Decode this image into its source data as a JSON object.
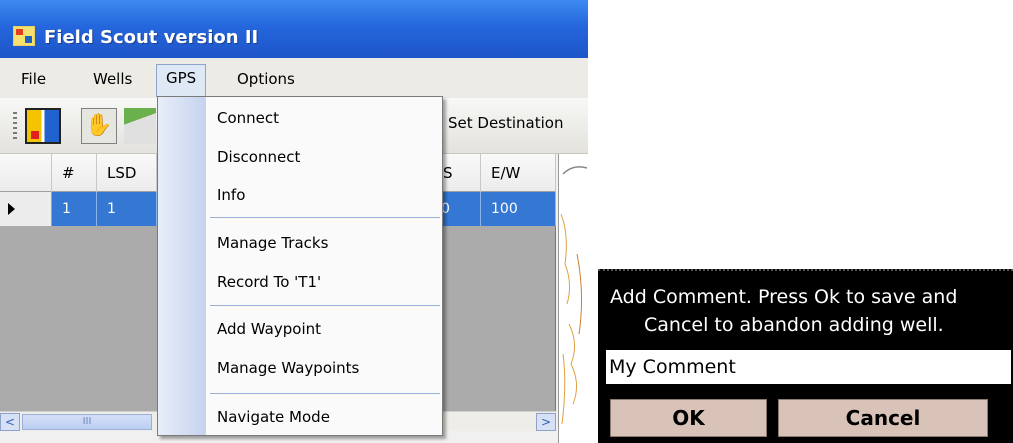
{
  "window": {
    "title": "Field Scout version II",
    "icon": "app-icon"
  },
  "menubar": {
    "items": [
      {
        "label": "File"
      },
      {
        "label": "Wells"
      },
      {
        "label": "GPS"
      },
      {
        "label": "Options"
      }
    ],
    "active": "GPS"
  },
  "toolbar": {
    "buttons": [
      "map-icon",
      "hand-icon",
      "route-icon"
    ],
    "text_button": "Set Destination"
  },
  "grid": {
    "columns": [
      "#",
      "LSD",
      "S",
      "E/W"
    ],
    "rows": [
      {
        "num": "1",
        "lsd": "1",
        "s": "0",
        "ew": "100"
      }
    ],
    "row_color": "#3478d3"
  },
  "gps_menu": {
    "items": [
      "Connect",
      "Disconnect",
      "Info",
      "Manage Tracks",
      "Record To 'T1'",
      "Add Waypoint",
      "Manage Waypoints",
      "Navigate Mode"
    ]
  },
  "scrollbar": {
    "thumb_glyph": "III",
    "left_glyph": "<",
    "right_glyph": ">"
  },
  "dialog": {
    "message_line1": "Add Comment. Press Ok to save and",
    "message_line2": "Cancel to abandon adding well.",
    "input_value": "My Comment",
    "ok_label": "OK",
    "cancel_label": "Cancel"
  }
}
